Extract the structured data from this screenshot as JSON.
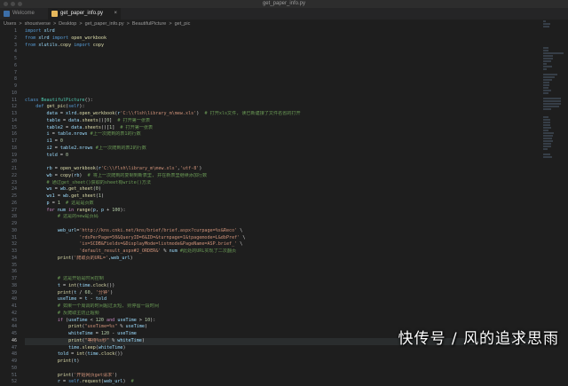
{
  "window": {
    "title": "get_paper_info.py"
  },
  "tabs": [
    {
      "label": "Welcome",
      "active": false
    },
    {
      "label": "get_paper_info.py",
      "active": true
    }
  ],
  "breadcrumb": [
    "Users",
    ">",
    "shouxiverse",
    ">",
    "Desktop",
    ">",
    "get_paper_info.py",
    ">",
    "BeautifulPicture",
    ">",
    "get_pic"
  ],
  "current_line": 46,
  "code": [
    {
      "n": "1",
      "t": "import xlrd"
    },
    {
      "n": "2",
      "t": "from xlrd import open_workbook"
    },
    {
      "n": "3",
      "t": "from xlutils.copy import copy"
    },
    {
      "n": "4",
      "t": ""
    },
    {
      "n": "5",
      "t": ""
    },
    {
      "n": "6",
      "t": ""
    },
    {
      "n": "7",
      "t": ""
    },
    {
      "n": "8",
      "t": ""
    },
    {
      "n": "9",
      "t": ""
    },
    {
      "n": "10",
      "t": ""
    },
    {
      "n": "11",
      "t": "class BeautifulPicture():"
    },
    {
      "n": "12",
      "t": "    def get_pic(self):"
    },
    {
      "n": "13",
      "t": "        data = xlrd.open_workbook(r'C:\\\\flsh\\library_m\\mew.xls')  # 打开xls文件, 读已新建接了文件名省的打开"
    },
    {
      "n": "14",
      "t": "        table = data.sheets()[0]  # 打开第一张表"
    },
    {
      "n": "15",
      "t": "        table2 = data.sheets()[1]  # 打开第一张表"
    },
    {
      "n": "16",
      "t": "        i = table.nrows #上一次爬到的表1的行数"
    },
    {
      "n": "17",
      "t": "        i1 = 0"
    },
    {
      "n": "18",
      "t": "        i2 = table2.nrows #上一次爬到的表2的行数"
    },
    {
      "n": "19",
      "t": "        told = 0"
    },
    {
      "n": "20",
      "t": ""
    },
    {
      "n": "21",
      "t": "        rb = open_workbook(r'C:\\\\flsh\\library_m\\mew.xls','utf-8')"
    },
    {
      "n": "22",
      "t": "        wb = copy(rb)  # 将上一次爬到的复制到新表里, 并在新表里继续添加行数"
    },
    {
      "n": "23",
      "t": "        # 通过get_sheet()获取的sheet有write()方法"
    },
    {
      "n": "24",
      "t": "        ws = wb.get_sheet(0)"
    },
    {
      "n": "25",
      "t": "        ws1 = wb.get_sheet(1)"
    },
    {
      "n": "26",
      "t": "        p = 1  # 这是是页数"
    },
    {
      "n": "27",
      "t": "        for num in range(p, p + 100):"
    },
    {
      "n": "28",
      "t": "            # 这是的new是页码"
    },
    {
      "n": "29",
      "t": ""
    },
    {
      "n": "30",
      "t": "            web_url='http://kns.cnki.net/kns/brief/brief.aspx?curpage=%s&Reco' \\"
    },
    {
      "n": "31",
      "t": "                    'rdsPerPage=50&QueryID=6&ID=&turnpage=1&tpagemode=L&dbPref' \\"
    },
    {
      "n": "32",
      "t": "                    'ix=SCDB&Fields=&DisplayMode=listmode&PageName=ASP.brief_' \\"
    },
    {
      "n": "33",
      "t": "                    'default_result_aspx#J_ORDER&' % num #此处的URL实现了二次翻页"
    },
    {
      "n": "34",
      "t": "            print('爬取页的URL=',web_url)"
    },
    {
      "n": "35",
      "t": ""
    },
    {
      "n": "36",
      "t": ""
    },
    {
      "n": "37",
      "t": "            # 这是开始是时间控制"
    },
    {
      "n": "38",
      "t": "            t = int(time.clock())"
    },
    {
      "n": "39",
      "t": "            print(t / 60, '分钟')"
    },
    {
      "n": "40",
      "t": "            useTime = t - told"
    },
    {
      "n": "41",
      "t": "            # 如果一个周调的时间超过太短, 则停留一段时间"
    },
    {
      "n": "42",
      "t": "            # 反爬取主防止超频"
    },
    {
      "n": "43",
      "t": "            if (useTime < 120 and useTime > 10):"
    },
    {
      "n": "44",
      "t": "                print(\"useTime=%s\" % useTime)"
    },
    {
      "n": "45",
      "t": "                whiteTime = 120 - useTime"
    },
    {
      "n": "46",
      "t": "                print(\"等待%s秒\" % whiteTime)"
    },
    {
      "n": "47",
      "t": "                time.sleep(whiteTime)"
    },
    {
      "n": "48",
      "t": "            told = int(time.clock())"
    },
    {
      "n": "49",
      "t": "            print(t)"
    },
    {
      "n": "50",
      "t": ""
    },
    {
      "n": "51",
      "t": "            print('开始网页get请求')"
    },
    {
      "n": "52",
      "t": "            r = self.request(web_url)  #"
    }
  ],
  "watermark": "快传号 / 风的追求思雨"
}
